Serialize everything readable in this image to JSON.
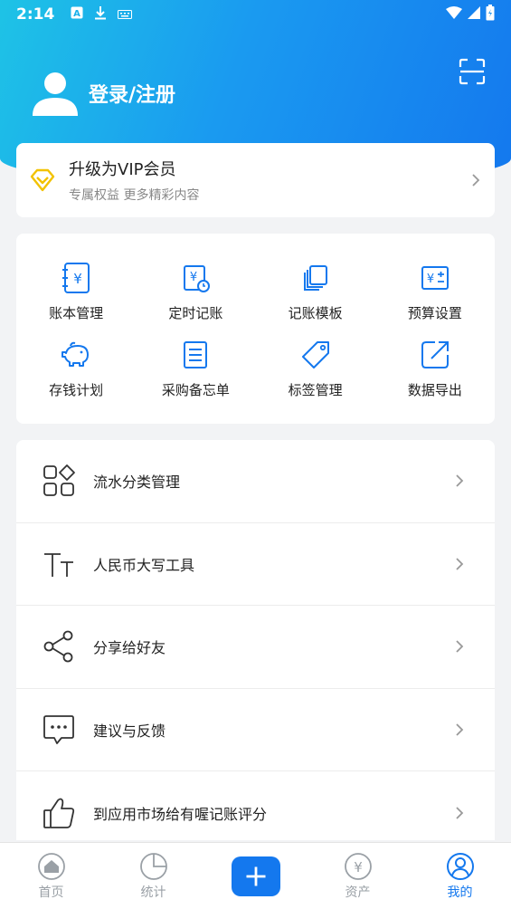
{
  "status_bar": {
    "time": "2:14"
  },
  "header": {
    "login_label": "登录/注册"
  },
  "vip": {
    "title": "升级为VIP会员",
    "subtitle": "专属权益 更多精彩内容"
  },
  "grid": [
    {
      "label": "账本管理",
      "icon": "ledger-icon"
    },
    {
      "label": "定时记账",
      "icon": "scheduled-bill-icon"
    },
    {
      "label": "记账模板",
      "icon": "template-icon"
    },
    {
      "label": "预算设置",
      "icon": "budget-icon"
    },
    {
      "label": "存钱计划",
      "icon": "piggy-bank-icon"
    },
    {
      "label": "采购备忘单",
      "icon": "memo-list-icon"
    },
    {
      "label": "标签管理",
      "icon": "tag-icon"
    },
    {
      "label": "数据导出",
      "icon": "export-icon"
    }
  ],
  "list": [
    {
      "label": "流水分类管理",
      "icon": "category-icon"
    },
    {
      "label": "人民币大写工具",
      "icon": "text-size-icon"
    },
    {
      "label": "分享给好友",
      "icon": "share-icon"
    },
    {
      "label": "建议与反馈",
      "icon": "feedback-icon"
    },
    {
      "label": "到应用市场给有喔记账评分",
      "icon": "thumbs-up-icon"
    }
  ],
  "tabs": [
    {
      "label": "首页",
      "icon": "home-icon"
    },
    {
      "label": "统计",
      "icon": "pie-chart-icon"
    },
    {
      "label": "",
      "icon": "plus-icon"
    },
    {
      "label": "资产",
      "icon": "yuan-icon"
    },
    {
      "label": "我的",
      "icon": "profile-icon",
      "active": true
    }
  ],
  "colors": {
    "accent": "#1478ee",
    "vip": "#f2c200"
  }
}
